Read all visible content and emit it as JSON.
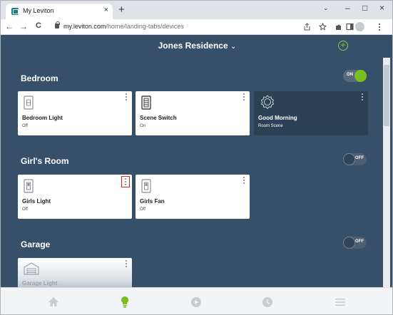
{
  "browser": {
    "tab_title": "My Leviton",
    "tab_close": "×",
    "new_tab": "+",
    "url_host": "my.leviton.com",
    "url_path": "/home/landing-tabs/devices",
    "back": "←",
    "forward": "→",
    "reload": "C",
    "minimize": "–",
    "maximize": "□",
    "close": "×",
    "tab_menu": "⌄"
  },
  "header": {
    "residence": "Jones Residence",
    "chevron": "⌄",
    "add": "+"
  },
  "colors": {
    "accent_green": "#78c01e",
    "app_background": "#365069",
    "selection_outline": "#e02020"
  },
  "rooms": [
    {
      "name": "Bedroom",
      "toggle": "ON",
      "devices": [
        {
          "name": "Bedroom Light",
          "state": "Off",
          "icon": "dimmer-switch-icon"
        },
        {
          "name": "Scene Switch",
          "state": "On",
          "icon": "scene-switch-icon"
        },
        {
          "name": "Good Morning",
          "state": "Room Scene",
          "icon": "scene-icon"
        }
      ]
    },
    {
      "name": "Girl's Room",
      "toggle": "OFF",
      "devices": [
        {
          "name": "Girls Light",
          "state": "Off",
          "icon": "light-switch-icon"
        },
        {
          "name": "Girls Fan",
          "state": "Off",
          "icon": "fan-switch-icon"
        }
      ]
    },
    {
      "name": "Garage",
      "toggle": "OFF",
      "devices": [
        {
          "name": "Garage Light",
          "state": "",
          "icon": "garage-icon"
        }
      ]
    }
  ],
  "bottom_nav": [
    "home-icon",
    "bulb-icon",
    "play-icon",
    "clock-icon",
    "menu-icon"
  ]
}
